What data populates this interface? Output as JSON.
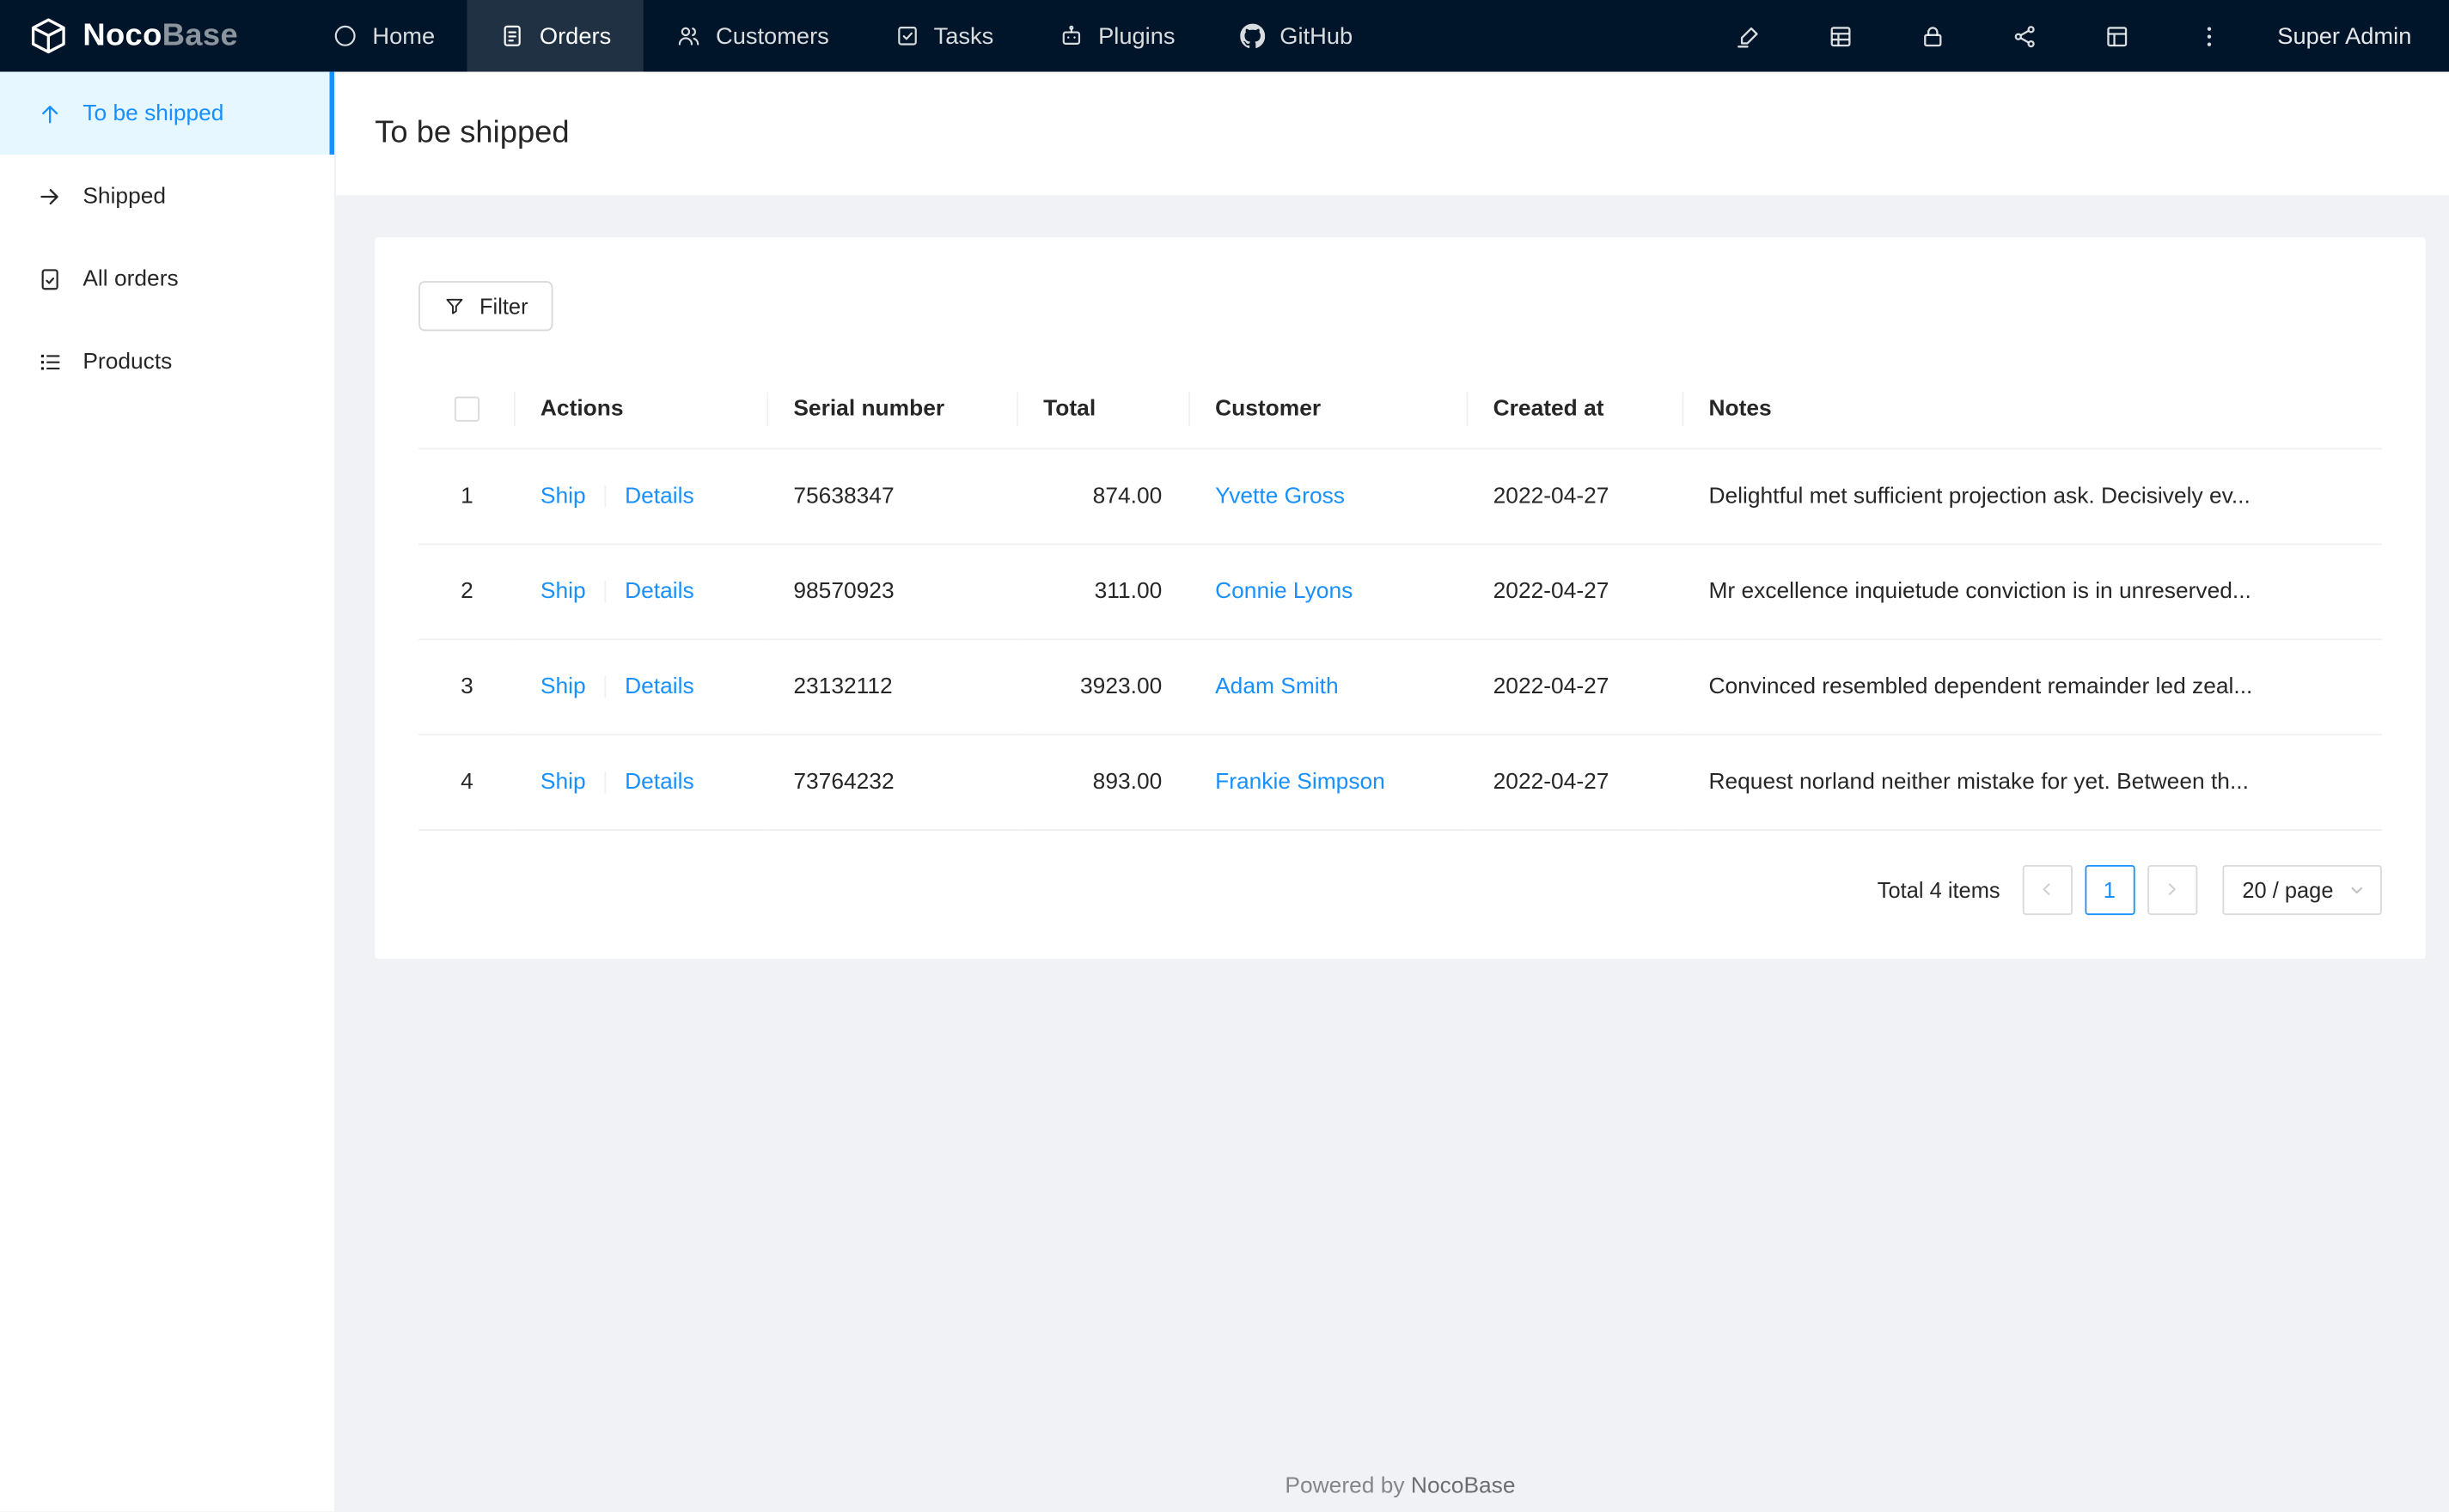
{
  "navbar": {
    "logo_noco": "Noco",
    "logo_base": "Base",
    "items": [
      {
        "label": "Home",
        "icon": "home-icon",
        "active": false
      },
      {
        "label": "Orders",
        "icon": "orders-icon",
        "active": true
      },
      {
        "label": "Customers",
        "icon": "customers-icon",
        "active": false
      },
      {
        "label": "Tasks",
        "icon": "tasks-icon",
        "active": false
      },
      {
        "label": "Plugins",
        "icon": "plugins-icon",
        "active": false
      },
      {
        "label": "GitHub",
        "icon": "github-icon",
        "active": false
      }
    ],
    "right_icons": [
      "design-mode-icon",
      "collections-icon",
      "lock-icon",
      "share-icon",
      "layout-icon",
      "more-icon"
    ],
    "user_label": "Super Admin"
  },
  "sidebar": {
    "items": [
      {
        "label": "To be shipped",
        "icon": "arrow-up-icon",
        "active": true
      },
      {
        "label": "Shipped",
        "icon": "arrow-right-icon",
        "active": false
      },
      {
        "label": "All orders",
        "icon": "file-check-icon",
        "active": false
      },
      {
        "label": "Products",
        "icon": "list-icon",
        "active": false
      }
    ]
  },
  "page": {
    "title": "To be shipped"
  },
  "toolbar": {
    "filter_label": "Filter"
  },
  "table": {
    "columns": [
      "Actions",
      "Serial number",
      "Total",
      "Customer",
      "Created at",
      "Notes"
    ],
    "action_ship": "Ship",
    "action_details": "Details",
    "rows": [
      {
        "index": "1",
        "serial": "75638347",
        "total": "874.00",
        "customer": "Yvette Gross",
        "created_at": "2022-04-27",
        "notes": "Delightful met sufficient projection ask. Decisively ev..."
      },
      {
        "index": "2",
        "serial": "98570923",
        "total": "311.00",
        "customer": "Connie Lyons",
        "created_at": "2022-04-27",
        "notes": "Mr excellence inquietude conviction is in unreserved..."
      },
      {
        "index": "3",
        "serial": "23132112",
        "total": "3923.00",
        "customer": "Adam Smith",
        "created_at": "2022-04-27",
        "notes": "Convinced resembled dependent remainder led zeal..."
      },
      {
        "index": "4",
        "serial": "73764232",
        "total": "893.00",
        "customer": "Frankie Simpson",
        "created_at": "2022-04-27",
        "notes": "Request norland neither mistake for yet. Between th..."
      }
    ]
  },
  "pagination": {
    "total_text": "Total 4 items",
    "current_page": "1",
    "page_size": "20 / page"
  },
  "footer": {
    "powered_by": "Powered by ",
    "brand": "NocoBase"
  },
  "colors": {
    "accent": "#1890ff",
    "navbar_bg": "#001529",
    "active_item_bg": "#e6f7ff",
    "link": "#1890ff",
    "content_bg": "#f0f2f5"
  }
}
